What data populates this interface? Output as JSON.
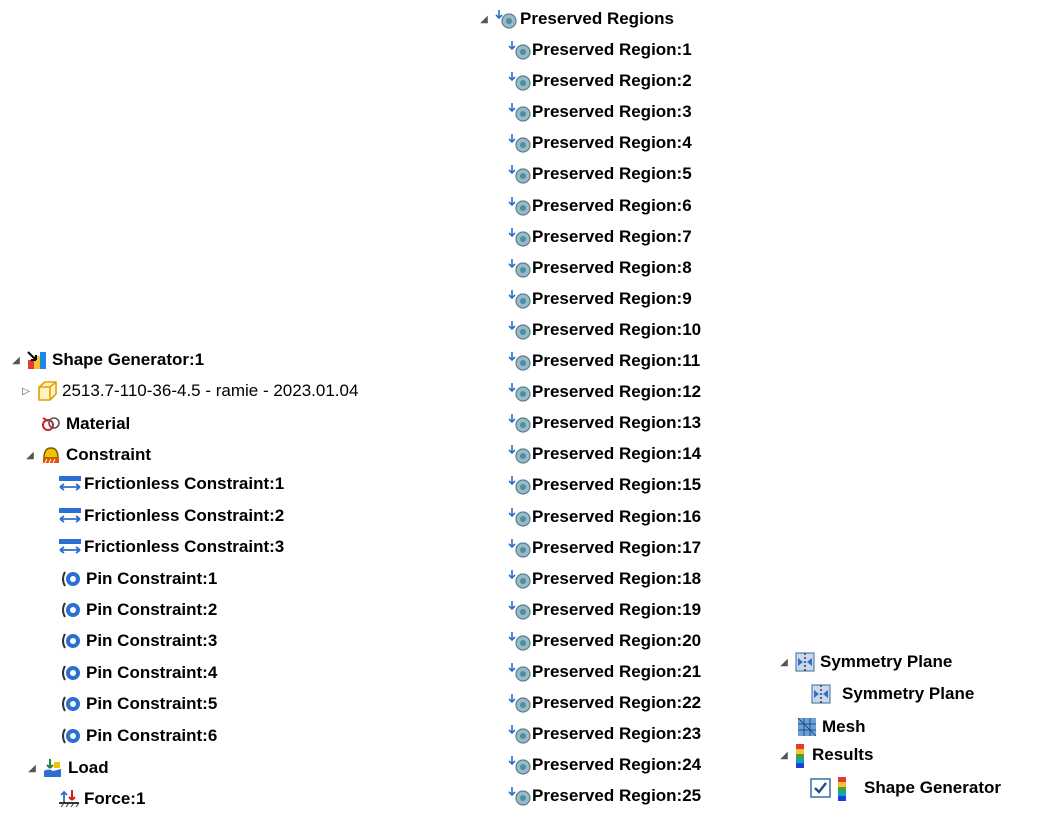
{
  "left_tree": {
    "root": {
      "label": "Shape Generator:1",
      "icon": "shape-generator-icon"
    },
    "part": {
      "label": "2513.7-110-36-4.5 - ramie - 2023.01.04",
      "icon": "part-cube-icon"
    },
    "material": {
      "label": "Material",
      "icon": "material-icon"
    },
    "constraint": {
      "label": "Constraint",
      "icon": "constraint-folder-icon"
    },
    "constraints": [
      {
        "label": "Frictionless Constraint:1",
        "icon": "frictionless-constraint-icon"
      },
      {
        "label": "Frictionless Constraint:2",
        "icon": "frictionless-constraint-icon"
      },
      {
        "label": "Frictionless Constraint:3",
        "icon": "frictionless-constraint-icon"
      },
      {
        "label": "Pin Constraint:1",
        "icon": "pin-constraint-icon"
      },
      {
        "label": "Pin Constraint:2",
        "icon": "pin-constraint-icon"
      },
      {
        "label": "Pin Constraint:3",
        "icon": "pin-constraint-icon"
      },
      {
        "label": "Pin Constraint:4",
        "icon": "pin-constraint-icon"
      },
      {
        "label": "Pin Constraint:5",
        "icon": "pin-constraint-icon"
      },
      {
        "label": "Pin Constraint:6",
        "icon": "pin-constraint-icon"
      }
    ],
    "load": {
      "label": "Load",
      "icon": "load-folder-icon"
    },
    "force": {
      "label": "Force:1",
      "icon": "force-icon"
    }
  },
  "middle_tree": {
    "header": {
      "label": "Preserved Regions",
      "icon": "preserved-region-icon"
    },
    "regions": [
      "Preserved Region:1",
      "Preserved Region:2",
      "Preserved Region:3",
      "Preserved Region:4",
      "Preserved Region:5",
      "Preserved Region:6",
      "Preserved Region:7",
      "Preserved Region:8",
      "Preserved Region:9",
      "Preserved Region:10",
      "Preserved Region:11",
      "Preserved Region:12",
      "Preserved Region:13",
      "Preserved Region:14",
      "Preserved Region:15",
      "Preserved Region:16",
      "Preserved Region:17",
      "Preserved Region:18",
      "Preserved Region:19",
      "Preserved Region:20",
      "Preserved Region:21",
      "Preserved Region:22",
      "Preserved Region:23",
      "Preserved Region:24",
      "Preserved Region:25"
    ]
  },
  "right_tree": {
    "symmetry_folder": {
      "label": "Symmetry Plane",
      "icon": "symmetry-plane-icon"
    },
    "symmetry_item": {
      "label": "Symmetry Plane",
      "icon": "symmetry-plane-icon"
    },
    "mesh": {
      "label": "Mesh",
      "icon": "mesh-icon"
    },
    "results": {
      "label": "Results",
      "icon": "results-icon"
    },
    "shape_generator_result": {
      "label": "Shape Generator",
      "icon": "results-icon",
      "checked": true
    }
  },
  "colors": {
    "constraint_blue": "#2b6fd1",
    "region_teal": "#4a8fa3",
    "force_red": "#d22020"
  }
}
